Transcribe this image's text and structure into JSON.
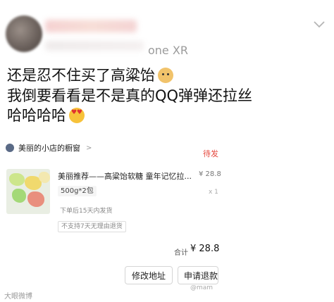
{
  "header": {
    "device_fragment": "one XR"
  },
  "post": {
    "lines": [
      "还是忍不住买了高粱饴",
      "我倒要看看是不是真的QQ弹弹还拉丝",
      "哈哈哈哈"
    ],
    "emojis": [
      "doge-emoji",
      "heart-eyes-emoji"
    ]
  },
  "order": {
    "shop_name": "美丽的小店的橱窗",
    "status": "待发",
    "product_title": "美丽推荐——高粱饴软糖 童年记忆拉...",
    "product_price": "¥ 28.8",
    "spec": "500g*2包",
    "quantity": "x 1",
    "shipping_note": "下单后15天内发货",
    "return_note": "不支持7天无理由退货",
    "total_label": "合计",
    "total_value": "¥ 28.8",
    "buttons": {
      "change_address": "修改地址",
      "refund": "申请退款"
    }
  },
  "watermarks": {
    "left": "大眼微博",
    "right": "@mam"
  },
  "colors": {
    "status_red": "#e5493f",
    "text_dark": "#111111",
    "muted": "#9b9b9b"
  }
}
